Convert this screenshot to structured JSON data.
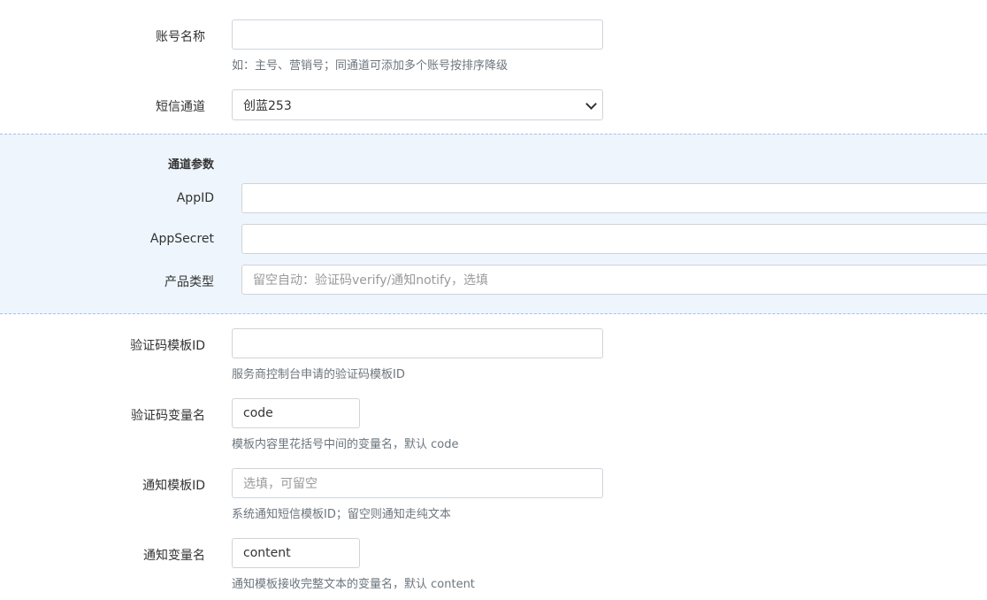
{
  "account": {
    "label": "账号名称",
    "value": "",
    "help": "如：主号、营销号；同通道可添加多个账号按排序降级"
  },
  "channel": {
    "label": "短信通道",
    "selected": "创蓝253"
  },
  "params": {
    "title": "通道参数",
    "app_id": {
      "label": "AppID",
      "value": ""
    },
    "app_secret": {
      "label": "AppSecret",
      "value": ""
    },
    "product_type": {
      "label": "产品类型",
      "placeholder": "留空自动：验证码verify/通知notify，选填"
    }
  },
  "verify_template": {
    "label": "验证码模板ID",
    "value": "",
    "help": "服务商控制台申请的验证码模板ID"
  },
  "verify_var": {
    "label": "验证码变量名",
    "value": "code",
    "help": "模板内容里花括号中间的变量名，默认 code"
  },
  "notify_template": {
    "label": "通知模板ID",
    "placeholder": "选填，可留空",
    "help": "系统通知短信模板ID；留空则通知走纯文本"
  },
  "notify_var": {
    "label": "通知变量名",
    "value": "content",
    "help": "通知模板接收完整文本的变量名，默认 content"
  }
}
